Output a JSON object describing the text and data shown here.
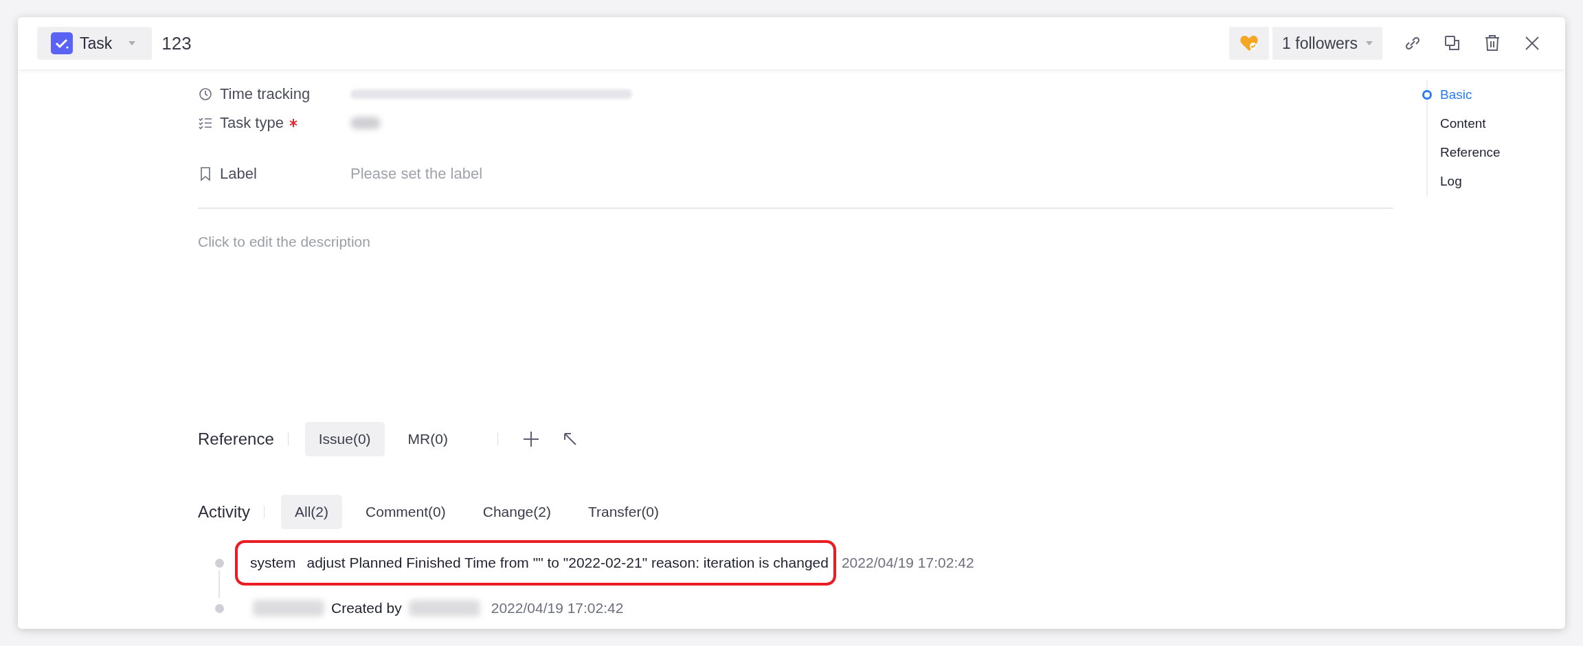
{
  "header": {
    "type_button": {
      "label": "Task"
    },
    "title": "123",
    "followers_button": {
      "label": "1 followers"
    }
  },
  "fields": [
    {
      "kind": "time",
      "label": "Time tracking",
      "required": false
    },
    {
      "kind": "type",
      "label": "Task type",
      "required": true
    },
    {
      "kind": "label",
      "label": "Label",
      "required": false,
      "placeholder": "Please set the label"
    }
  ],
  "description": {
    "placeholder": "Click to edit the description"
  },
  "reference": {
    "title": "Reference",
    "tabs": [
      {
        "label": "Issue(0)",
        "selected": true
      },
      {
        "label": "MR(0)",
        "selected": false
      }
    ]
  },
  "activity": {
    "title": "Activity",
    "tabs": [
      {
        "label": "All(2)",
        "selected": true
      },
      {
        "label": "Comment(0)",
        "selected": false
      },
      {
        "label": "Change(2)",
        "selected": false
      },
      {
        "label": "Transfer(0)",
        "selected": false
      }
    ],
    "entries": [
      {
        "kind": "change",
        "author": "system",
        "text": "adjust Planned Finished Time from \"\" to \"2022-02-21\" reason: iteration is changed",
        "time": "2022/04/19 17:02:42",
        "highlighted": true
      },
      {
        "kind": "created",
        "text": "Created by",
        "time": "2022/04/19 17:02:42",
        "highlighted": false
      }
    ]
  },
  "nav": [
    {
      "label": "Basic",
      "selected": true
    },
    {
      "label": "Content",
      "selected": false
    },
    {
      "label": "Reference",
      "selected": false
    },
    {
      "label": "Log",
      "selected": false
    }
  ]
}
